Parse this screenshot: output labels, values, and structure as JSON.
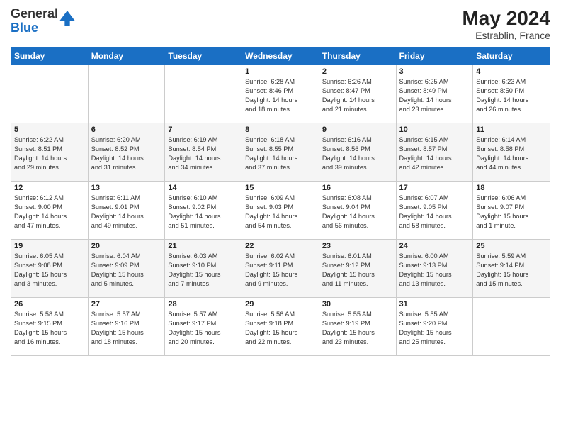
{
  "logo": {
    "general": "General",
    "blue": "Blue"
  },
  "title": {
    "month_year": "May 2024",
    "location": "Estrablin, France"
  },
  "weekdays": [
    "Sunday",
    "Monday",
    "Tuesday",
    "Wednesday",
    "Thursday",
    "Friday",
    "Saturday"
  ],
  "weeks": [
    [
      {
        "day": "",
        "info": ""
      },
      {
        "day": "",
        "info": ""
      },
      {
        "day": "",
        "info": ""
      },
      {
        "day": "1",
        "info": "Sunrise: 6:28 AM\nSunset: 8:46 PM\nDaylight: 14 hours\nand 18 minutes."
      },
      {
        "day": "2",
        "info": "Sunrise: 6:26 AM\nSunset: 8:47 PM\nDaylight: 14 hours\nand 21 minutes."
      },
      {
        "day": "3",
        "info": "Sunrise: 6:25 AM\nSunset: 8:49 PM\nDaylight: 14 hours\nand 23 minutes."
      },
      {
        "day": "4",
        "info": "Sunrise: 6:23 AM\nSunset: 8:50 PM\nDaylight: 14 hours\nand 26 minutes."
      }
    ],
    [
      {
        "day": "5",
        "info": "Sunrise: 6:22 AM\nSunset: 8:51 PM\nDaylight: 14 hours\nand 29 minutes."
      },
      {
        "day": "6",
        "info": "Sunrise: 6:20 AM\nSunset: 8:52 PM\nDaylight: 14 hours\nand 31 minutes."
      },
      {
        "day": "7",
        "info": "Sunrise: 6:19 AM\nSunset: 8:54 PM\nDaylight: 14 hours\nand 34 minutes."
      },
      {
        "day": "8",
        "info": "Sunrise: 6:18 AM\nSunset: 8:55 PM\nDaylight: 14 hours\nand 37 minutes."
      },
      {
        "day": "9",
        "info": "Sunrise: 6:16 AM\nSunset: 8:56 PM\nDaylight: 14 hours\nand 39 minutes."
      },
      {
        "day": "10",
        "info": "Sunrise: 6:15 AM\nSunset: 8:57 PM\nDaylight: 14 hours\nand 42 minutes."
      },
      {
        "day": "11",
        "info": "Sunrise: 6:14 AM\nSunset: 8:58 PM\nDaylight: 14 hours\nand 44 minutes."
      }
    ],
    [
      {
        "day": "12",
        "info": "Sunrise: 6:12 AM\nSunset: 9:00 PM\nDaylight: 14 hours\nand 47 minutes."
      },
      {
        "day": "13",
        "info": "Sunrise: 6:11 AM\nSunset: 9:01 PM\nDaylight: 14 hours\nand 49 minutes."
      },
      {
        "day": "14",
        "info": "Sunrise: 6:10 AM\nSunset: 9:02 PM\nDaylight: 14 hours\nand 51 minutes."
      },
      {
        "day": "15",
        "info": "Sunrise: 6:09 AM\nSunset: 9:03 PM\nDaylight: 14 hours\nand 54 minutes."
      },
      {
        "day": "16",
        "info": "Sunrise: 6:08 AM\nSunset: 9:04 PM\nDaylight: 14 hours\nand 56 minutes."
      },
      {
        "day": "17",
        "info": "Sunrise: 6:07 AM\nSunset: 9:05 PM\nDaylight: 14 hours\nand 58 minutes."
      },
      {
        "day": "18",
        "info": "Sunrise: 6:06 AM\nSunset: 9:07 PM\nDaylight: 15 hours\nand 1 minute."
      }
    ],
    [
      {
        "day": "19",
        "info": "Sunrise: 6:05 AM\nSunset: 9:08 PM\nDaylight: 15 hours\nand 3 minutes."
      },
      {
        "day": "20",
        "info": "Sunrise: 6:04 AM\nSunset: 9:09 PM\nDaylight: 15 hours\nand 5 minutes."
      },
      {
        "day": "21",
        "info": "Sunrise: 6:03 AM\nSunset: 9:10 PM\nDaylight: 15 hours\nand 7 minutes."
      },
      {
        "day": "22",
        "info": "Sunrise: 6:02 AM\nSunset: 9:11 PM\nDaylight: 15 hours\nand 9 minutes."
      },
      {
        "day": "23",
        "info": "Sunrise: 6:01 AM\nSunset: 9:12 PM\nDaylight: 15 hours\nand 11 minutes."
      },
      {
        "day": "24",
        "info": "Sunrise: 6:00 AM\nSunset: 9:13 PM\nDaylight: 15 hours\nand 13 minutes."
      },
      {
        "day": "25",
        "info": "Sunrise: 5:59 AM\nSunset: 9:14 PM\nDaylight: 15 hours\nand 15 minutes."
      }
    ],
    [
      {
        "day": "26",
        "info": "Sunrise: 5:58 AM\nSunset: 9:15 PM\nDaylight: 15 hours\nand 16 minutes."
      },
      {
        "day": "27",
        "info": "Sunrise: 5:57 AM\nSunset: 9:16 PM\nDaylight: 15 hours\nand 18 minutes."
      },
      {
        "day": "28",
        "info": "Sunrise: 5:57 AM\nSunset: 9:17 PM\nDaylight: 15 hours\nand 20 minutes."
      },
      {
        "day": "29",
        "info": "Sunrise: 5:56 AM\nSunset: 9:18 PM\nDaylight: 15 hours\nand 22 minutes."
      },
      {
        "day": "30",
        "info": "Sunrise: 5:55 AM\nSunset: 9:19 PM\nDaylight: 15 hours\nand 23 minutes."
      },
      {
        "day": "31",
        "info": "Sunrise: 5:55 AM\nSunset: 9:20 PM\nDaylight: 15 hours\nand 25 minutes."
      },
      {
        "day": "",
        "info": ""
      }
    ]
  ]
}
